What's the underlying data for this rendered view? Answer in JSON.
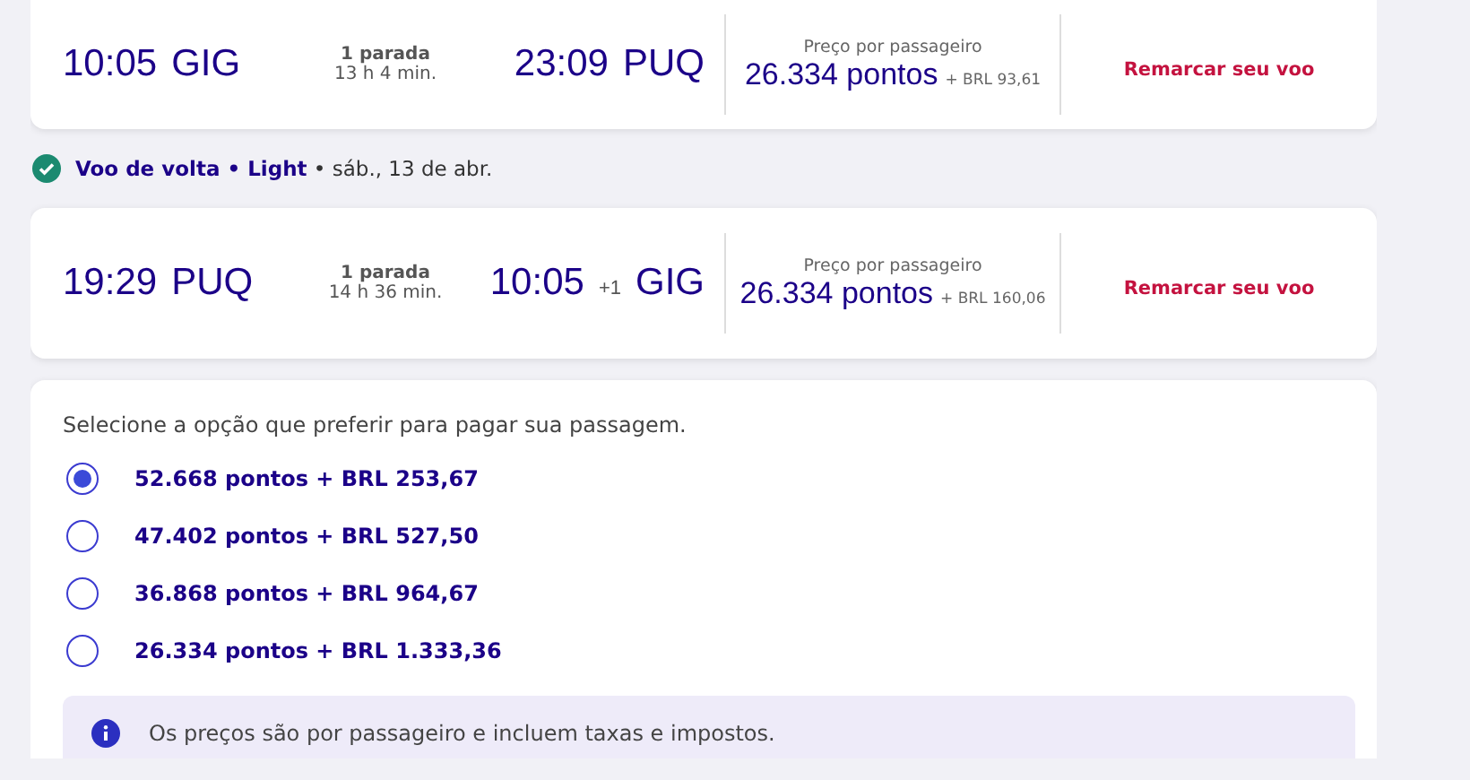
{
  "flights": [
    {
      "departure_time": "10:05",
      "departure_airport": "GIG",
      "stops": "1 parada",
      "duration": "13 h 4 min.",
      "arrival_time": "23:09",
      "arrival_airport": "PUQ",
      "price_label": "Preço por passageiro",
      "points": "26.334 pontos",
      "cash": "+ BRL 93,61",
      "action": "Remarcar seu voo"
    },
    {
      "heading": "**Voo de volta • Light** • sáb., 13 de abr.",
      "heading_confirmed": true,
      "departure_time": "19:29",
      "departure_airport": "PUQ",
      "stops": "1 parada",
      "duration": "14 h 36 min.",
      "arrival_time": "10:05",
      "arrival_day_offset": "+1",
      "arrival_airport": "GIG",
      "price_label": "Preço por passageiro",
      "points": "26.334 pontos",
      "cash": "+ BRL 160,06",
      "action": "Remarcar seu voo"
    }
  ],
  "payment": {
    "instruction": "Selecione a opção que preferir para pagar sua passagem.",
    "options": [
      {
        "label": "52.668 pontos + BRL 253,67",
        "selected": true
      },
      {
        "label": "47.402 pontos + BRL 527,50",
        "selected": false
      },
      {
        "label": "36.868 pontos + BRL 964,67",
        "selected": false
      },
      {
        "label": "26.334 pontos + BRL 1.333,36",
        "selected": false
      }
    ],
    "info": "Os preços são por passageiro e incluem taxas e impostos."
  }
}
